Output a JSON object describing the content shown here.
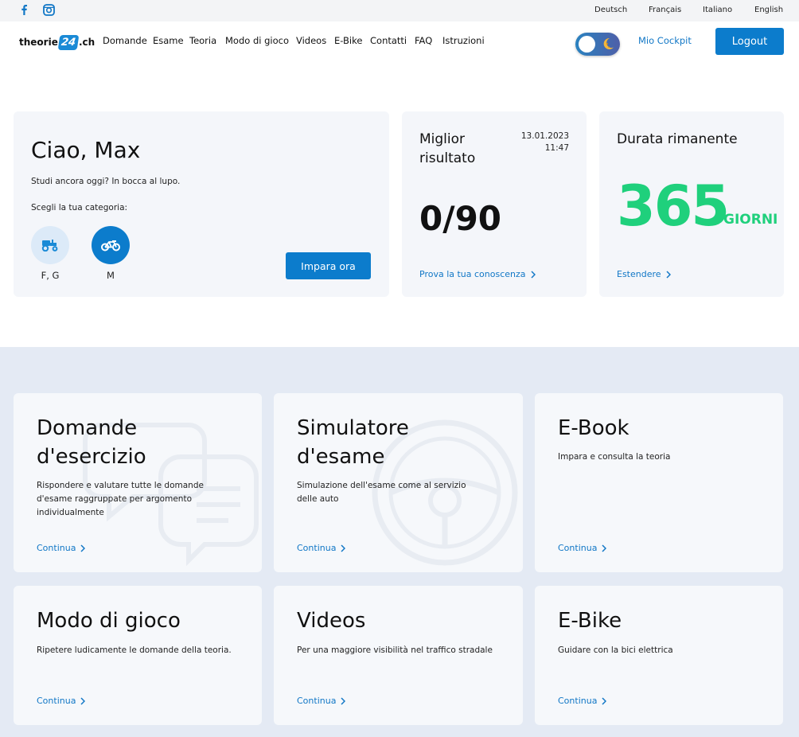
{
  "languages": [
    "Deutsch",
    "Français",
    "Italiano",
    "English"
  ],
  "logo": {
    "left": "theorie",
    "badge": "24",
    "right": ".ch"
  },
  "nav": [
    "Domande",
    "Esame",
    "Teoria",
    "Modo di gioco",
    "Videos",
    "E-Bike",
    "Contatti",
    "FAQ",
    "Istruzioni"
  ],
  "header": {
    "cockpit": "Mio Cockpit",
    "logout": "Logout"
  },
  "welcome": {
    "title": "Ciao, Max",
    "subtitle": "Studi ancora oggi? In bocca al lupo.",
    "category_label": "Scegli la tua categoria:",
    "categories": [
      {
        "name": "F, G",
        "icon": "tractor-icon"
      },
      {
        "name": "M",
        "icon": "moped-icon"
      }
    ],
    "cta": "Impara ora"
  },
  "best_result": {
    "title": "Miglior risultato",
    "date": "13.01.2023",
    "time": "11:47",
    "score": "0/90",
    "link": "Prova la tua conoscenza"
  },
  "remaining": {
    "title": "Durata rimanente",
    "value": "365",
    "unit": "GIORNI",
    "link": "Estendere"
  },
  "features": [
    {
      "title": "Domande d'esercizio",
      "desc": "Rispondere e valutare tutte le domande d'esame raggruppate per argomento individualmente",
      "link": "Continua"
    },
    {
      "title": "Simulatore d'esame",
      "desc": "Simulazione dell'esame come al servizio delle auto",
      "link": "Continua"
    },
    {
      "title": "E-Book",
      "desc": "Impara e consulta la teoria",
      "link": "Continua"
    },
    {
      "title": "Modo di gioco",
      "desc": "Ripetere ludicamente le domande della teoria.",
      "link": "Continua"
    },
    {
      "title": "Videos",
      "desc": "Per una maggiore visibilità nel traffico stradale",
      "link": "Continua"
    },
    {
      "title": "E-Bike",
      "desc": "Guidare con la bici elettrica",
      "link": "Continua"
    }
  ],
  "colors": {
    "accent": "#0c7ccc",
    "link": "#1177c6",
    "success": "#1fd07c",
    "section_bg": "#e4eaf4"
  }
}
